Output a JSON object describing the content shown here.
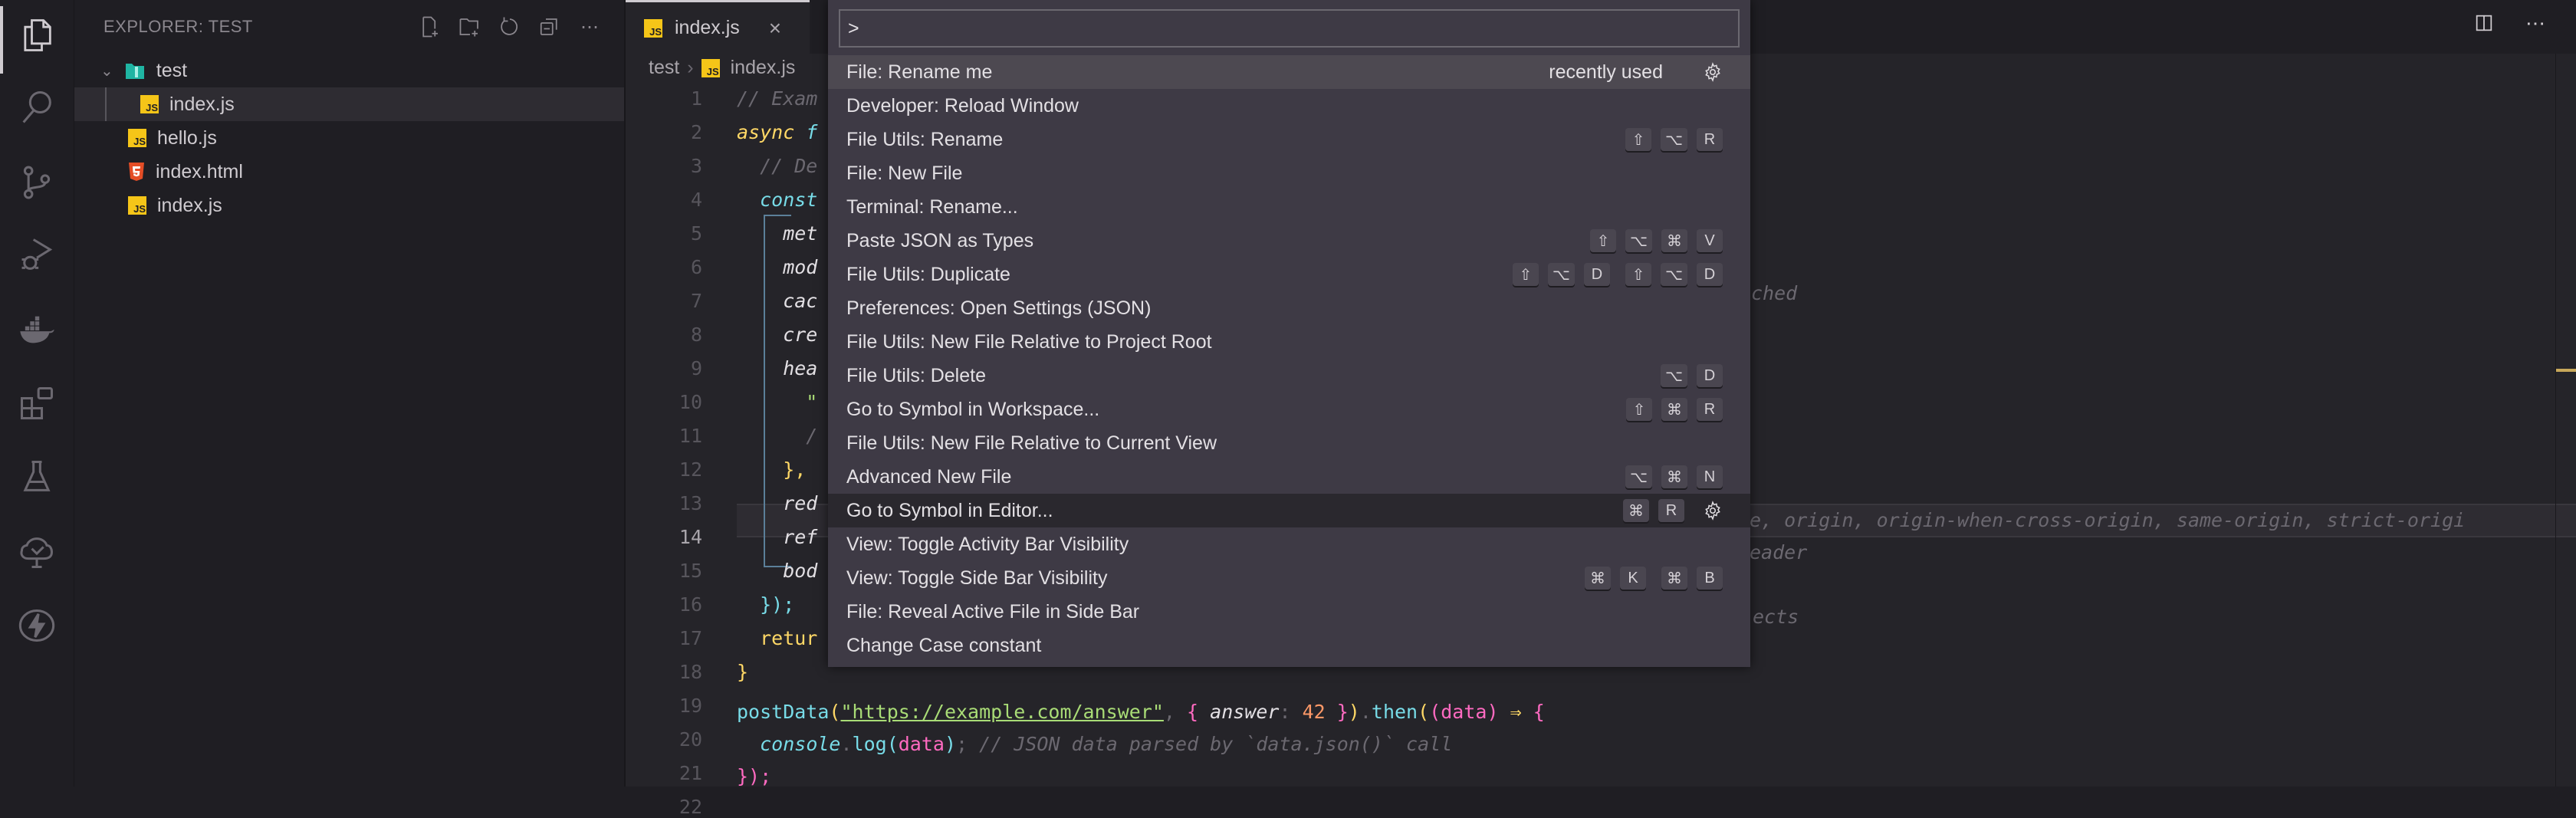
{
  "activity_bar": {
    "icons": [
      "files-icon",
      "search-icon",
      "source-control-icon",
      "run-debug-icon",
      "docker-icon",
      "extensions-icon",
      "testing-icon",
      "gitlens-tree-icon",
      "lightning-icon"
    ]
  },
  "sidebar": {
    "title": "EXPLORER: TEST",
    "actions": [
      "new-file-icon",
      "new-folder-icon",
      "refresh-icon",
      "collapse-all-icon",
      "more-icon"
    ],
    "tree": [
      {
        "label": "test",
        "type": "folder",
        "expanded": true,
        "depth": 0
      },
      {
        "label": "index.js",
        "type": "js",
        "depth": 1,
        "selected": true
      },
      {
        "label": "hello.js",
        "type": "js",
        "depth": 0
      },
      {
        "label": "index.html",
        "type": "html",
        "depth": 0
      },
      {
        "label": "index.js",
        "type": "js",
        "depth": 0
      }
    ]
  },
  "editor": {
    "tab": {
      "label": "index.js",
      "close": "×"
    },
    "breadcrumb": [
      "test",
      "index.js"
    ],
    "lines": [
      {
        "n": "1"
      },
      {
        "n": "2"
      },
      {
        "n": "3"
      },
      {
        "n": "4"
      },
      {
        "n": "5"
      },
      {
        "n": "6"
      },
      {
        "n": "7"
      },
      {
        "n": "8"
      },
      {
        "n": "9"
      },
      {
        "n": "10"
      },
      {
        "n": "11"
      },
      {
        "n": "12"
      },
      {
        "n": "13"
      },
      {
        "n": "14"
      },
      {
        "n": "15"
      },
      {
        "n": "16"
      },
      {
        "n": "17"
      },
      {
        "n": "18"
      },
      {
        "n": "19"
      },
      {
        "n": "20"
      },
      {
        "n": "21"
      },
      {
        "n": "22"
      }
    ],
    "code": {
      "l1": "// Exam",
      "l2_kw": "async",
      "l2_rest": " f",
      "l3": "  // De",
      "l4": "  const",
      "l5": "    met",
      "l6": "    mod",
      "l7": "    cac",
      "l8": "    cre",
      "l8_tail": "ched",
      "l9": "    hea",
      "l10": "      \"",
      "l11": "      /",
      "l12": "    },",
      "l13": "    red",
      "l14": "    ref",
      "l14_tail": "e, origin, origin-when-cross-origin, same-origin, strict-origi",
      "l15": "    bod",
      "l15_tail": "eader",
      "l16": "  });",
      "l17": "  retur",
      "l17_tail": "ects",
      "l18": "}",
      "l20_fn": "postData",
      "l20_str": "\"https://example.com/answer\"",
      "l20_prop": "answer",
      "l20_num": "42",
      "l20_then": "then",
      "l20_arg": "data",
      "l20_arrow": "⇒",
      "l21_obj": "console",
      "l21_fn": "log",
      "l21_arg": "data",
      "l21_cmt": "// JSON data parsed by `data.json()` call",
      "l22": "});"
    }
  },
  "command_palette": {
    "input_value": ">",
    "items": [
      {
        "label": "File: Rename me",
        "extra": "recently used",
        "gear": true,
        "keys": []
      },
      {
        "label": "Developer: Reload Window",
        "keys": []
      },
      {
        "label": "File Utils: Rename",
        "keys": [
          [
            "⇧",
            "⌥",
            "R"
          ]
        ]
      },
      {
        "label": "File: New File",
        "keys": []
      },
      {
        "label": "Terminal: Rename...",
        "keys": []
      },
      {
        "label": "Paste JSON as Types",
        "keys": [
          [
            "⇧",
            "⌥",
            "⌘",
            "V"
          ]
        ]
      },
      {
        "label": "File Utils: Duplicate",
        "keys": [
          [
            "⇧",
            "⌥",
            "D"
          ],
          [
            "⇧",
            "⌥",
            "D"
          ]
        ]
      },
      {
        "label": "Preferences: Open Settings (JSON)",
        "keys": []
      },
      {
        "label": "File Utils: New File Relative to Project Root",
        "keys": []
      },
      {
        "label": "File Utils: Delete",
        "keys": [
          [
            "⌥",
            "D"
          ]
        ]
      },
      {
        "label": "Go to Symbol in Workspace...",
        "keys": [
          [
            "⇧",
            "⌘",
            "R"
          ]
        ]
      },
      {
        "label": "File Utils: New File Relative to Current View",
        "keys": []
      },
      {
        "label": "Advanced New File",
        "keys": [
          [
            "⌥",
            "⌘",
            "N"
          ]
        ]
      },
      {
        "label": "Go to Symbol in Editor...",
        "keys": [
          [
            "⌘",
            "R"
          ]
        ],
        "gear": true,
        "hover": true
      },
      {
        "label": "View: Toggle Activity Bar Visibility",
        "keys": []
      },
      {
        "label": "View: Toggle Side Bar Visibility",
        "keys": [
          [
            "⌘",
            "K"
          ],
          [
            "⌘",
            "B"
          ]
        ]
      },
      {
        "label": "File: Reveal Active File in Side Bar",
        "keys": []
      },
      {
        "label": "Change Case constant",
        "keys": []
      }
    ]
  },
  "title_actions": [
    "split-editor-icon",
    "more-actions-icon"
  ],
  "colors": {
    "accent_js": "#f5c518",
    "html": "#e44d26",
    "folder": "#1fb5a3"
  }
}
